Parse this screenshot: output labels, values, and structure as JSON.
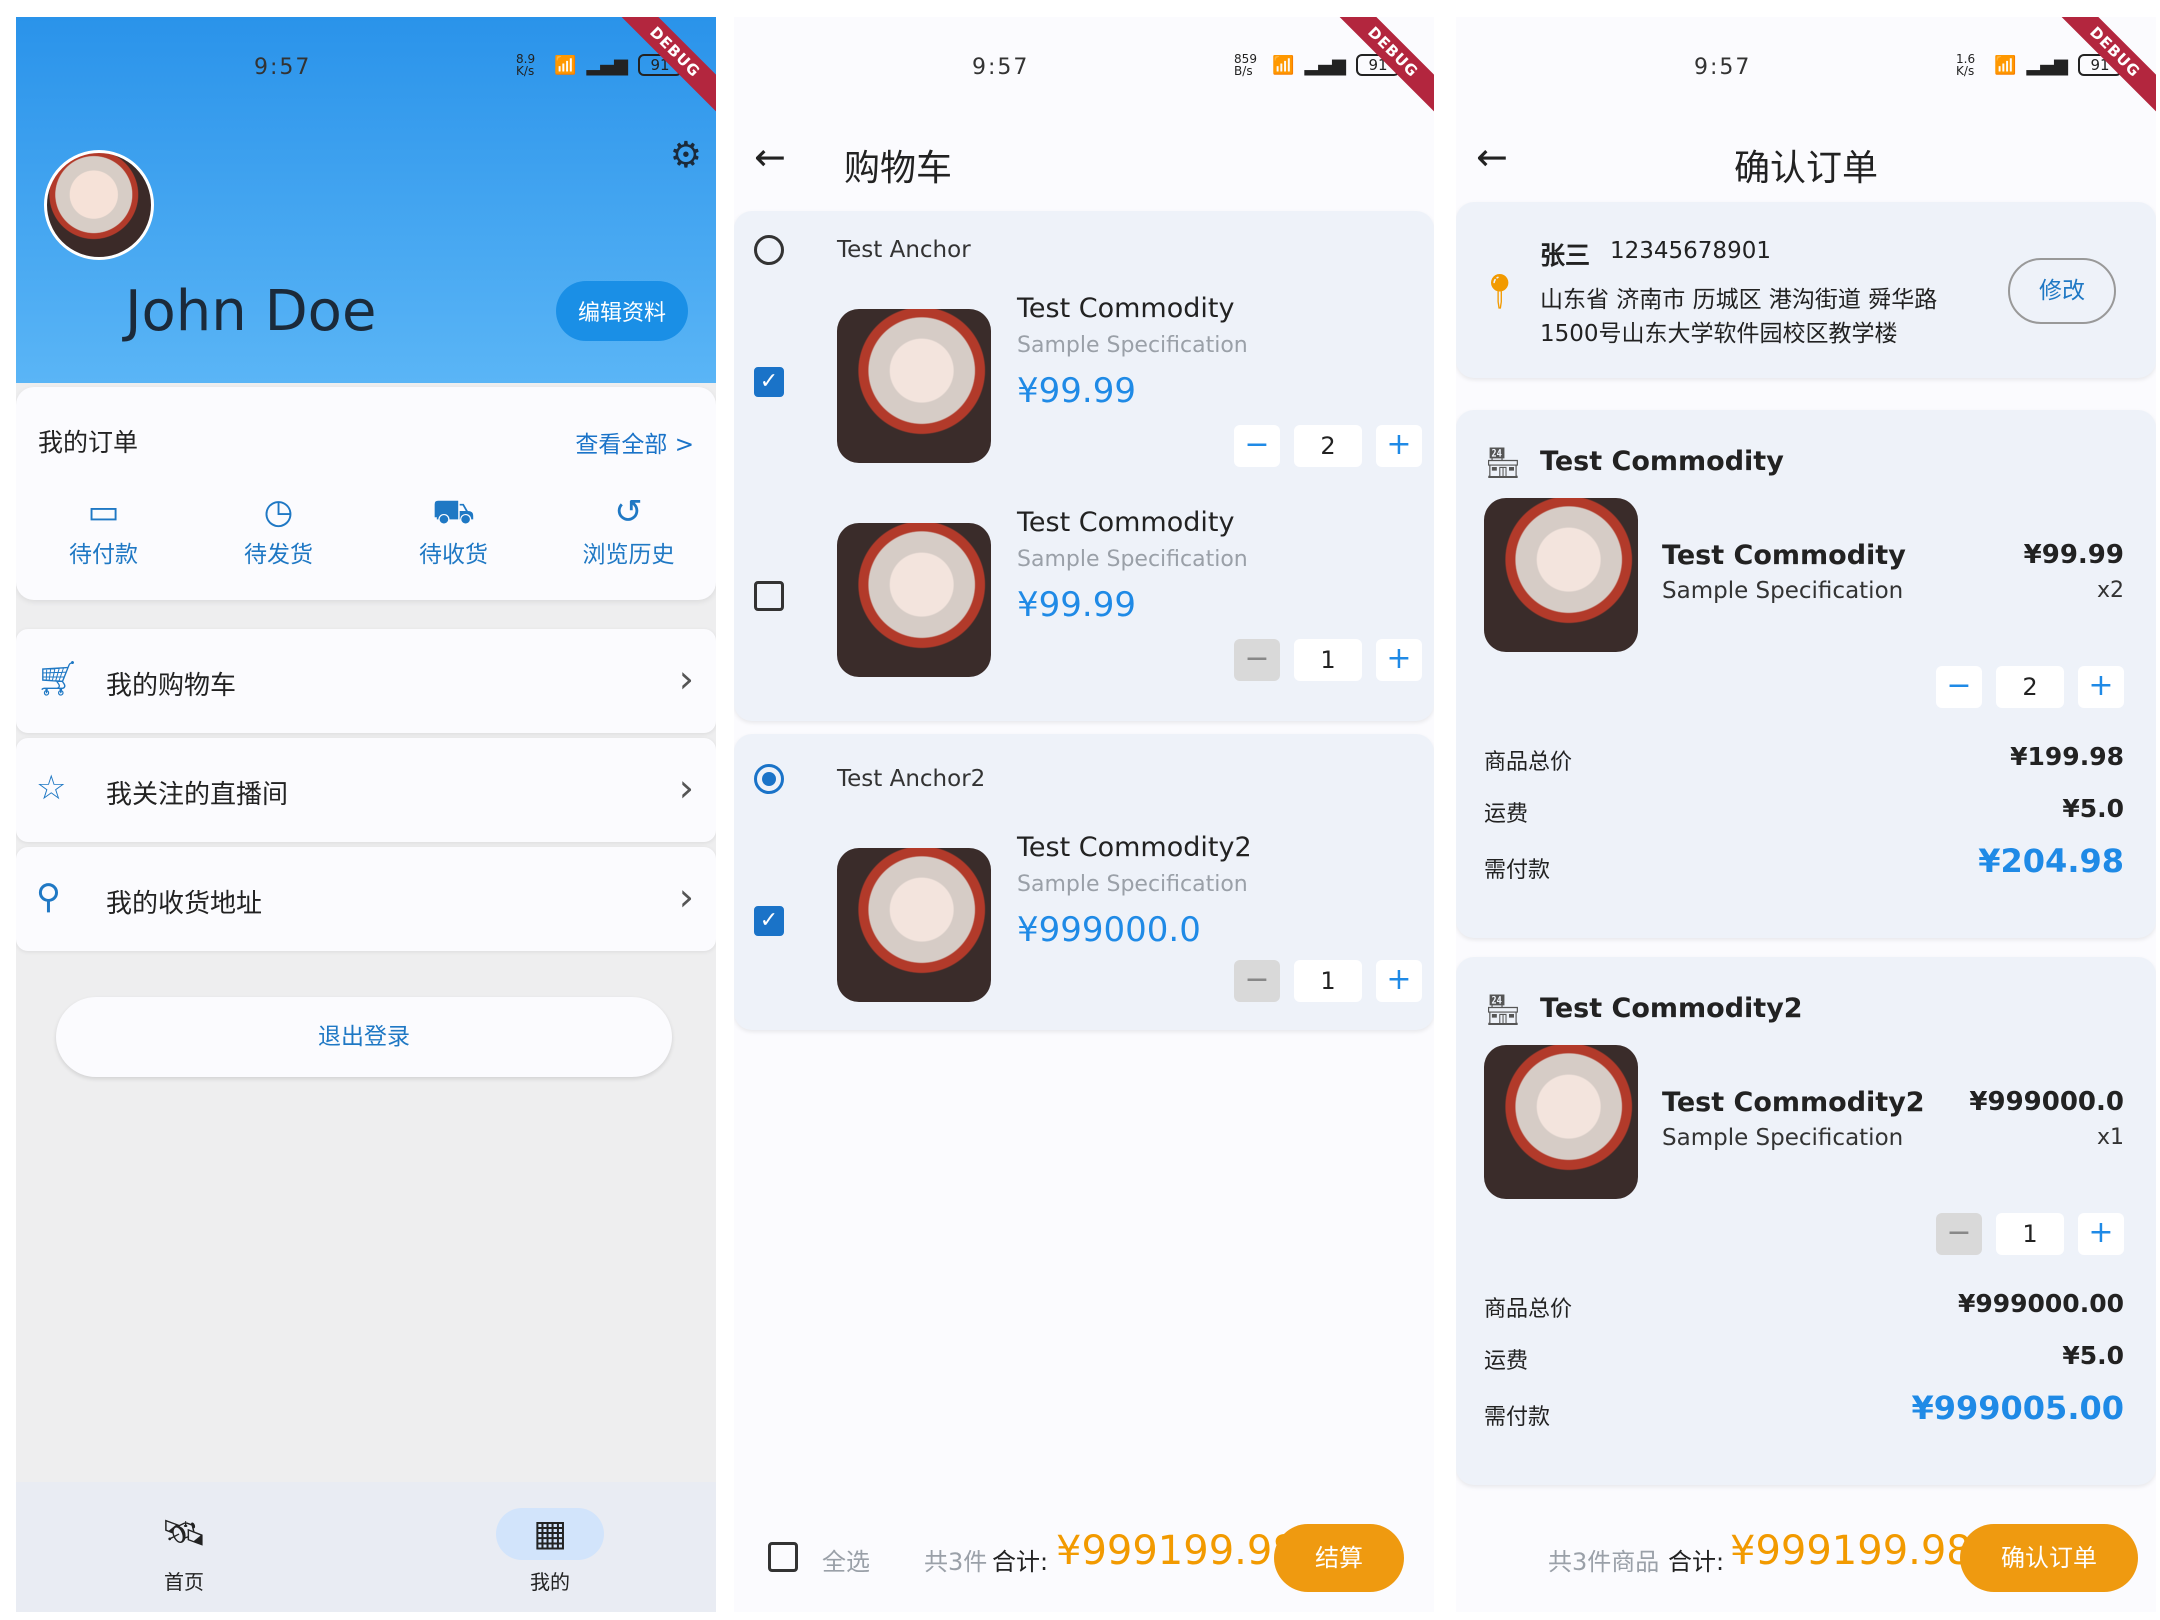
{
  "status": {
    "screen1": {
      "time": "9:57",
      "net": "8.9 K/s",
      "battery": "91"
    },
    "screen2": {
      "time": "9:57",
      "net": "859 B/s",
      "battery": "91"
    },
    "screen3": {
      "time": "9:57",
      "net": "1.6 K/s",
      "battery": "91"
    },
    "debug": "DEBUG"
  },
  "profile": {
    "username": "John Doe",
    "edit_label": "编辑资料",
    "orders_title": "我的订单",
    "view_all": "查看全部 >",
    "order_tabs": [
      {
        "icon": "card-icon",
        "label": "待付款"
      },
      {
        "icon": "clock-icon",
        "label": "待发货"
      },
      {
        "icon": "truck-icon",
        "label": "待收货"
      },
      {
        "icon": "history-icon",
        "label": "浏览历史"
      }
    ],
    "menu": [
      {
        "icon": "cart-icon",
        "label": "我的购物车"
      },
      {
        "icon": "star-icon",
        "label": "我关注的直播间"
      },
      {
        "icon": "location-icon",
        "label": "我的收货地址"
      }
    ],
    "logout": "退出登录",
    "nav": [
      {
        "icon": "satellite-icon",
        "label": "首页"
      },
      {
        "icon": "grid-icon",
        "label": "我的"
      }
    ]
  },
  "cart": {
    "title": "购物车",
    "groups": [
      {
        "anchor": "Test Anchor",
        "selected": false,
        "items": [
          {
            "name": "Test Commodity",
            "spec": "Sample Specification",
            "price": "¥99.99",
            "qty": "2",
            "checked": true
          },
          {
            "name": "Test Commodity",
            "spec": "Sample Specification",
            "price": "¥99.99",
            "qty": "1",
            "checked": false
          }
        ]
      },
      {
        "anchor": "Test Anchor2",
        "selected": true,
        "items": [
          {
            "name": "Test Commodity2",
            "spec": "Sample Specification",
            "price": "¥999000.0",
            "qty": "1",
            "checked": true
          }
        ]
      }
    ],
    "select_all": "全选",
    "count_label": "共3件",
    "sum_label": "合计:",
    "sum_value": "¥999199.98",
    "checkout": "结算"
  },
  "confirm": {
    "title": "确认订单",
    "address": {
      "name": "张三",
      "phone": "12345678901",
      "line1": "山东省 济南市 历城区 港沟街道 舜华路",
      "line2": "1500号山东大学软件园校区教学楼",
      "modify": "修改"
    },
    "orders": [
      {
        "store": "Test Commodity",
        "name": "Test Commodity",
        "spec": "Sample Specification",
        "price": "¥99.99",
        "qty_label": "x2",
        "qty": "2",
        "goods_total_label": "商品总价",
        "goods_total": "¥199.98",
        "shipping_label": "运费",
        "shipping": "¥5.0",
        "payable_label": "需付款",
        "payable": "¥204.98"
      },
      {
        "store": "Test Commodity2",
        "name": "Test Commodity2",
        "spec": "Sample Specification",
        "price": "¥999000.0",
        "qty_label": "x1",
        "qty": "1",
        "goods_total_label": "商品总价",
        "goods_total": "¥999000.00",
        "shipping_label": "运费",
        "shipping": "¥5.0",
        "payable_label": "需付款",
        "payable": "¥999005.00"
      }
    ],
    "count_label": "共3件商品",
    "sum_label": "合计:",
    "sum_value": "¥999199.98",
    "confirm_button": "确认订单"
  },
  "colors": {
    "primary": "#1f8ae6",
    "accent": "#ef9a10",
    "header_top": "#2a93ea",
    "header_bottom": "#5ab5f6"
  }
}
